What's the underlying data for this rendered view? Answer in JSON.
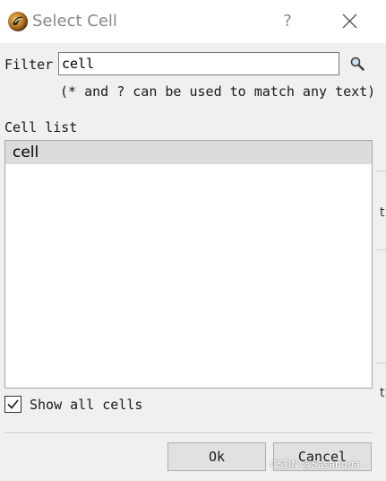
{
  "window": {
    "title": "Select Cell",
    "help_label": "?"
  },
  "filter": {
    "label": "Filter",
    "value": "cell",
    "hint": "(* and ? can be used to match any text)"
  },
  "cell_list": {
    "label": "Cell list",
    "items": [
      {
        "name": "cell",
        "selected": true
      }
    ]
  },
  "show_all": {
    "label": "Show all cells",
    "checked": true
  },
  "buttons": {
    "ok": "Ok",
    "cancel": "Cancel"
  },
  "background": {
    "edge_glyphs": [
      "t",
      "t"
    ]
  },
  "watermark": "CSDN @Sasanqua",
  "colors": {
    "title_text": "#888888",
    "selection": "#dcdcdc",
    "button_bg": "#e1e1e1"
  }
}
